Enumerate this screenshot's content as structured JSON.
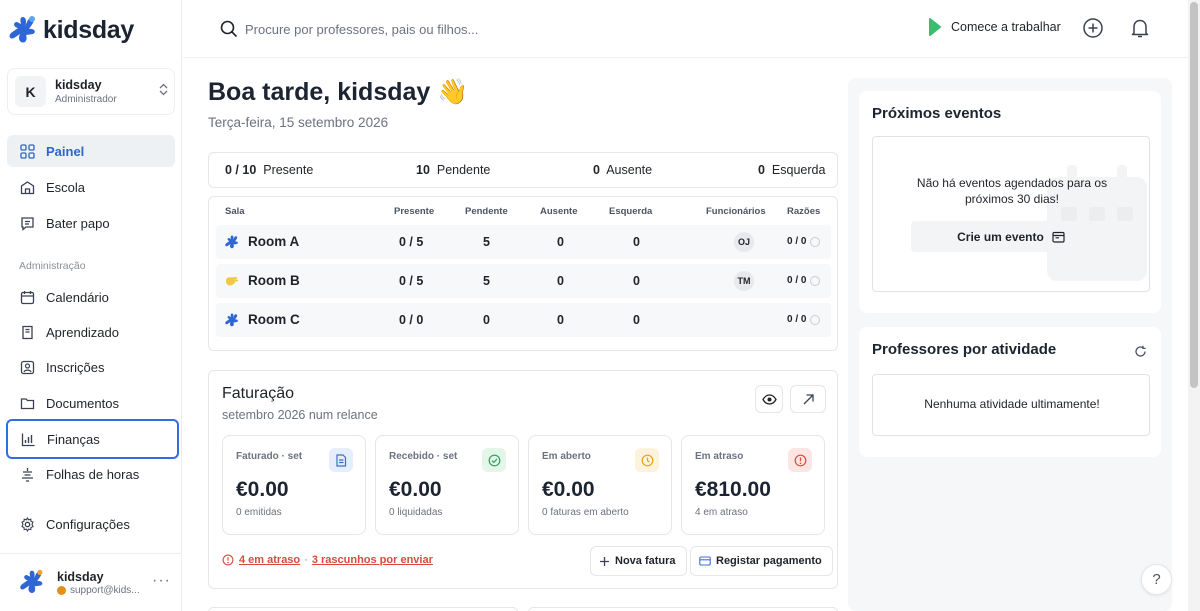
{
  "brand": {
    "name": "kidsday"
  },
  "org": {
    "initial": "K",
    "name": "kidsday",
    "role": "Administrador"
  },
  "nav": {
    "main": [
      {
        "label": "Painel",
        "icon": "dashboard-icon"
      },
      {
        "label": "Escola",
        "icon": "school-icon"
      },
      {
        "label": "Bater papo",
        "icon": "chat-icon"
      }
    ],
    "section_label": "Administração",
    "admin": [
      {
        "label": "Calendário",
        "icon": "calendar-icon"
      },
      {
        "label": "Aprendizado",
        "icon": "learning-icon"
      },
      {
        "label": "Inscrições",
        "icon": "enrollment-icon"
      },
      {
        "label": "Documentos",
        "icon": "folder-icon"
      },
      {
        "label": "Finanças",
        "icon": "finance-icon"
      },
      {
        "label": "Folhas de horas",
        "icon": "timesheet-icon"
      }
    ],
    "settings": {
      "label": "Configurações",
      "icon": "gear-icon"
    }
  },
  "user": {
    "name": "kidsday",
    "email": "support@kids...",
    "more": "···"
  },
  "search": {
    "placeholder": "Procure por professores, pais ou filhos..."
  },
  "topbar": {
    "start_work": "Comece a trabalhar"
  },
  "greeting": {
    "title": "Boa tarde, kidsday 👋",
    "date": "Terça-feira, 15 setembro 2026"
  },
  "attendance_summary": {
    "present_value": "0 / 10",
    "present_label": "Presente",
    "pending_value": "10",
    "pending_label": "Pendente",
    "absent_value": "0",
    "absent_label": "Ausente",
    "left_value": "0",
    "left_label": "Esquerda"
  },
  "attendance_table": {
    "headers": [
      "Sala",
      "Presente",
      "Pendente",
      "Ausente",
      "Esquerda",
      "Funcionários",
      "Razões"
    ],
    "rows": [
      {
        "room": "Room A",
        "icon": "kidsday-room-icon",
        "present": "0 / 5",
        "pending": "5",
        "absent": "0",
        "left": "0",
        "staff": "OJ",
        "reasons": "0 / 0"
      },
      {
        "room": "Room B",
        "icon": "hand-room-icon",
        "present": "0 / 5",
        "pending": "5",
        "absent": "0",
        "left": "0",
        "staff": "TM",
        "reasons": "0 / 0"
      },
      {
        "room": "Room C",
        "icon": "kidsday-room-icon",
        "present": "0 / 0",
        "pending": "0",
        "absent": "0",
        "left": "0",
        "staff": "",
        "reasons": "0 / 0"
      }
    ]
  },
  "billing": {
    "title": "Faturação",
    "subtitle": "setembro 2026 num relance",
    "stats": [
      {
        "label": "Faturado · set",
        "value": "€0.00",
        "note": "0 emitidas",
        "icon": "invoice-icon",
        "color": "#3b6fd4",
        "bg": "#e6edfb"
      },
      {
        "label": "Recebido · set",
        "value": "€0.00",
        "note": "0 liquidadas",
        "icon": "check-circle-icon",
        "color": "#2f9e5b",
        "bg": "#e4f5ea"
      },
      {
        "label": "Em aberto",
        "value": "€0.00",
        "note": "0 faturas em aberto",
        "icon": "clock-icon",
        "color": "#e3a21a",
        "bg": "#fdf3dc"
      },
      {
        "label": "Em atraso",
        "value": "€810.00",
        "note": "4 em atraso",
        "icon": "alert-circle-icon",
        "color": "#d94a3d",
        "bg": "#fbe6e4"
      }
    ],
    "overdue_link": "4 em atraso",
    "separator": "·",
    "drafts_link": "3 rascunhos por enviar",
    "new_invoice": "Nova fatura",
    "register_payment": "Registar pagamento"
  },
  "events": {
    "title": "Próximos eventos",
    "empty": "Não há eventos agendados para os próximos 30 dias!",
    "create": "Crie um evento"
  },
  "activity": {
    "title": "Professores por atividade",
    "empty": "Nenhuma atividade ultimamente!"
  },
  "help": "?"
}
